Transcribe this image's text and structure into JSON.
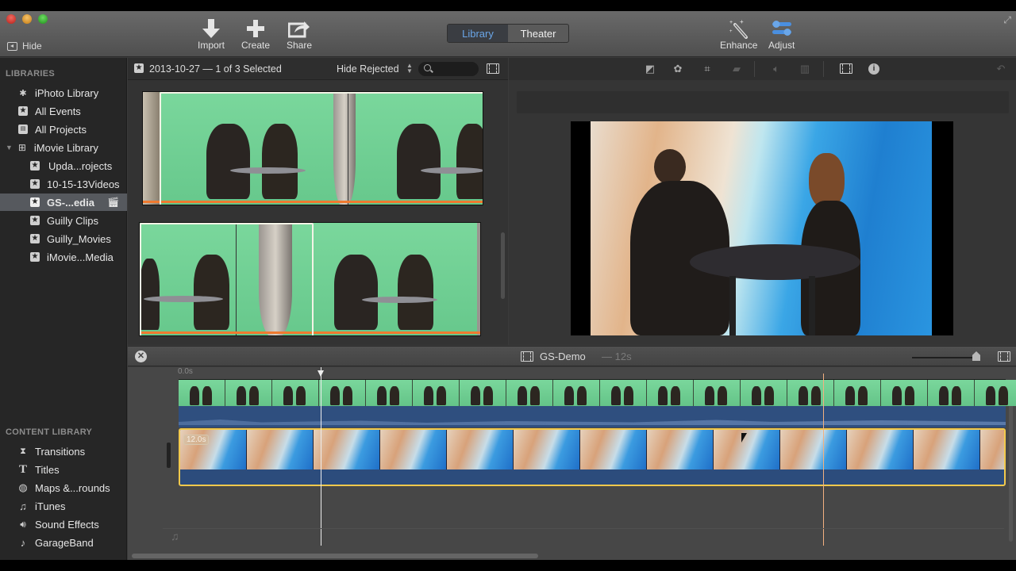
{
  "window": {
    "hide_label": "Hide",
    "toolbar": {
      "import_label": "Import",
      "create_label": "Create",
      "share_label": "Share",
      "enhance_label": "Enhance",
      "adjust_label": "Adjust"
    },
    "mode_tabs": [
      {
        "label": "Library",
        "active": true
      },
      {
        "label": "Theater",
        "active": false
      }
    ]
  },
  "sidebar": {
    "libraries_heading": "LIBRARIES",
    "libraries": [
      {
        "label": "iPhoto Library",
        "icon": "palm-tree-icon",
        "indent": 0
      },
      {
        "label": "All Events",
        "icon": "star-icon",
        "indent": 0
      },
      {
        "label": "All Projects",
        "icon": "film-projects-icon",
        "indent": 0
      },
      {
        "label": "iMovie Library",
        "icon": "grid-library-icon",
        "indent": 0,
        "expanded": true
      },
      {
        "label": "Upda...rojects",
        "icon": "star-icon",
        "indent": 1
      },
      {
        "label": "10-15-13Videos",
        "icon": "star-icon",
        "indent": 1
      },
      {
        "label": "GS-...edia",
        "icon": "star-icon",
        "indent": 1,
        "selected": true,
        "badge": "clapper-icon"
      },
      {
        "label": "Guilly Clips",
        "icon": "star-icon",
        "indent": 1
      },
      {
        "label": "Guilly_Movies",
        "icon": "star-icon",
        "indent": 1
      },
      {
        "label": "iMovie...Media",
        "icon": "star-icon",
        "indent": 1
      }
    ],
    "content_heading": "CONTENT LIBRARY",
    "content": [
      {
        "label": "Transitions",
        "icon": "transitions-icon"
      },
      {
        "label": "Titles",
        "icon": "titles-icon"
      },
      {
        "label": "Maps &...rounds",
        "icon": "globe-icon"
      },
      {
        "label": "iTunes",
        "icon": "music-note-icon"
      },
      {
        "label": "Sound Effects",
        "icon": "speaker-icon"
      },
      {
        "label": "GarageBand",
        "icon": "guitar-icon"
      }
    ]
  },
  "browser": {
    "event_title": "2013-10-27 — 1 of 3 Selected",
    "filter_value": "Hide Rejected",
    "search_placeholder": ""
  },
  "viewer": {
    "tools": [
      "color-balance-icon",
      "color-correction-icon",
      "crop-icon",
      "stabilization-icon",
      "volume-icon",
      "equalizer-icon",
      "clip-filter-icon",
      "info-icon"
    ],
    "undo_icon": "revert-icon"
  },
  "timeline": {
    "project_name": "GS-Demo",
    "project_duration": "— 12s",
    "ruler_start": "0.0s",
    "cutaway_duration": "12.0s"
  },
  "colors": {
    "accent_blue": "#6aa6e8",
    "clip_selected_border": "#f2c94c",
    "audio_track": "#2f4f7f",
    "favorite_bar": "#f07a30"
  }
}
